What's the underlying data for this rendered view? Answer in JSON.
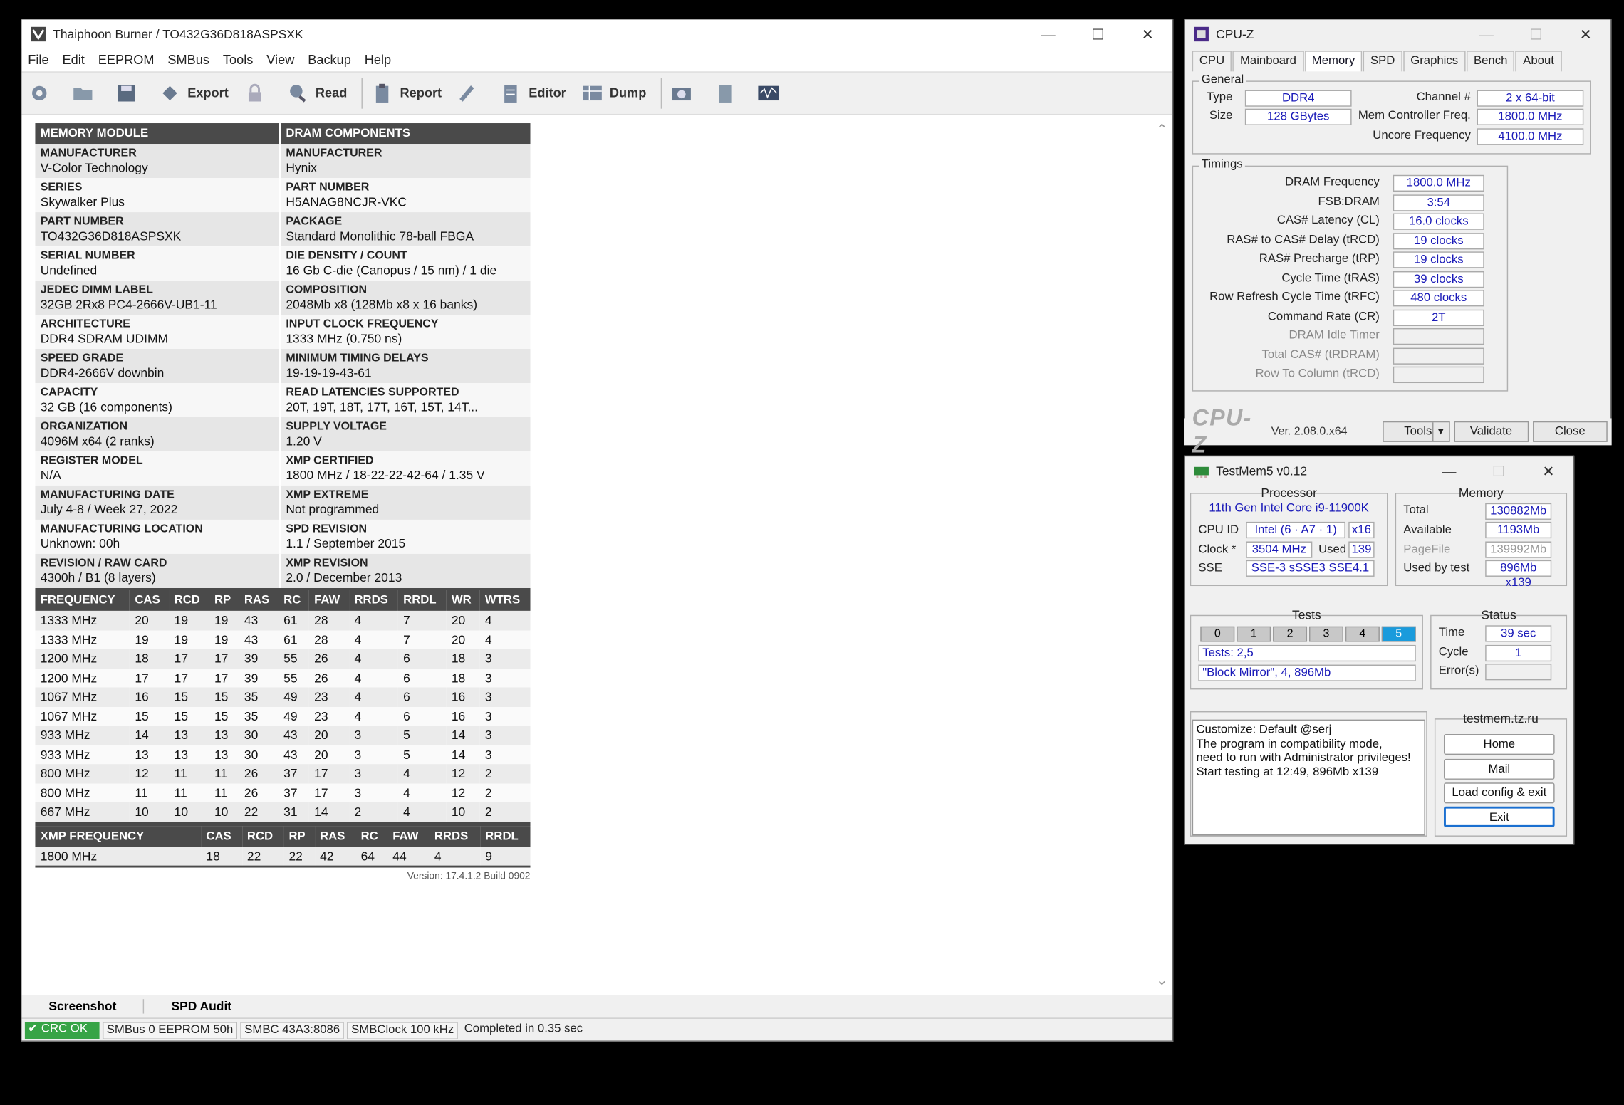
{
  "thaiphoon": {
    "title": "Thaiphoon Burner / TO432G36D818ASPSXK",
    "menu": [
      "File",
      "Edit",
      "EEPROM",
      "SMBus",
      "Tools",
      "View",
      "Backup",
      "Help"
    ],
    "toolbar": {
      "export": "Export",
      "read": "Read",
      "report": "Report",
      "editor": "Editor",
      "dump": "Dump"
    },
    "module_header": "MEMORY MODULE",
    "dram_header": "DRAM COMPONENTS",
    "rows": [
      {
        "l1": "MANUFACTURER",
        "v1": "V-Color Technology",
        "l2": "MANUFACTURER",
        "v2": "Hynix"
      },
      {
        "l1": "SERIES",
        "v1": "Skywalker Plus",
        "l2": "PART NUMBER",
        "v2": "H5ANAG8NCJR-VKC"
      },
      {
        "l1": "PART NUMBER",
        "v1": "TO432G36D818ASPSXK",
        "l2": "PACKAGE",
        "v2": "Standard Monolithic 78-ball FBGA"
      },
      {
        "l1": "SERIAL NUMBER",
        "v1": "Undefined",
        "l2": "DIE DENSITY / COUNT",
        "v2": "16 Gb C-die (Canopus / 15 nm) / 1 die"
      },
      {
        "l1": "JEDEC DIMM LABEL",
        "v1": "32GB 2Rx8 PC4-2666V-UB1-11",
        "l2": "COMPOSITION",
        "v2": "2048Mb x8 (128Mb x8 x 16 banks)"
      },
      {
        "l1": "ARCHITECTURE",
        "v1": "DDR4 SDRAM UDIMM",
        "l2": "INPUT CLOCK FREQUENCY",
        "v2": "1333 MHz (0.750 ns)"
      },
      {
        "l1": "SPEED GRADE",
        "v1": "DDR4-2666V downbin",
        "l2": "MINIMUM TIMING DELAYS",
        "v2": "19-19-19-43-61"
      },
      {
        "l1": "CAPACITY",
        "v1": "32 GB (16 components)",
        "l2": "READ LATENCIES SUPPORTED",
        "v2": "20T, 19T, 18T, 17T, 16T, 15T, 14T..."
      },
      {
        "l1": "ORGANIZATION",
        "v1": "4096M x64 (2 ranks)",
        "l2": "SUPPLY VOLTAGE",
        "v2": "1.20 V"
      },
      {
        "l1": "REGISTER MODEL",
        "v1": "N/A",
        "l2": "XMP CERTIFIED",
        "v2": "1800 MHz / 18-22-22-42-64 / 1.35 V"
      },
      {
        "l1": "MANUFACTURING DATE",
        "v1": "July 4-8 / Week 27, 2022",
        "l2": "XMP EXTREME",
        "v2": "Not programmed"
      },
      {
        "l1": "MANUFACTURING LOCATION",
        "v1": "Unknown: 00h",
        "l2": "SPD REVISION",
        "v2": "1.1 / September 2015"
      },
      {
        "l1": "REVISION / RAW CARD",
        "v1": "4300h / B1 (8 layers)",
        "l2": "XMP REVISION",
        "v2": "2.0 / December 2013"
      }
    ],
    "freq_headers": [
      "FREQUENCY",
      "CAS",
      "RCD",
      "RP",
      "RAS",
      "RC",
      "FAW",
      "RRDS",
      "RRDL",
      "WR",
      "WTRS"
    ],
    "freq_rows": [
      [
        "1333 MHz",
        "20",
        "19",
        "19",
        "43",
        "61",
        "28",
        "4",
        "7",
        "20",
        "4"
      ],
      [
        "1333 MHz",
        "19",
        "19",
        "19",
        "43",
        "61",
        "28",
        "4",
        "7",
        "20",
        "4"
      ],
      [
        "1200 MHz",
        "18",
        "17",
        "17",
        "39",
        "55",
        "26",
        "4",
        "6",
        "18",
        "3"
      ],
      [
        "1200 MHz",
        "17",
        "17",
        "17",
        "39",
        "55",
        "26",
        "4",
        "6",
        "18",
        "3"
      ],
      [
        "1067 MHz",
        "16",
        "15",
        "15",
        "35",
        "49",
        "23",
        "4",
        "6",
        "16",
        "3"
      ],
      [
        "1067 MHz",
        "15",
        "15",
        "15",
        "35",
        "49",
        "23",
        "4",
        "6",
        "16",
        "3"
      ],
      [
        "933 MHz",
        "14",
        "13",
        "13",
        "30",
        "43",
        "20",
        "3",
        "5",
        "14",
        "3"
      ],
      [
        "933 MHz",
        "13",
        "13",
        "13",
        "30",
        "43",
        "20",
        "3",
        "5",
        "14",
        "3"
      ],
      [
        "800 MHz",
        "12",
        "11",
        "11",
        "26",
        "37",
        "17",
        "3",
        "4",
        "12",
        "2"
      ],
      [
        "800 MHz",
        "11",
        "11",
        "11",
        "26",
        "37",
        "17",
        "3",
        "4",
        "12",
        "2"
      ],
      [
        "667 MHz",
        "10",
        "10",
        "10",
        "22",
        "31",
        "14",
        "2",
        "4",
        "10",
        "2"
      ]
    ],
    "xmp_headers": [
      "XMP FREQUENCY",
      "CAS",
      "RCD",
      "RP",
      "RAS",
      "RC",
      "FAW",
      "RRDS",
      "RRDL"
    ],
    "xmp_rows": [
      [
        "1800 MHz",
        "18",
        "22",
        "22",
        "42",
        "64",
        "44",
        "4",
        "9"
      ]
    ],
    "version": "Version: 17.4.1.2 Build 0902",
    "bottom_tabs": {
      "screenshot": "Screenshot",
      "audit": "SPD Audit"
    },
    "status": {
      "crc": "CRC OK",
      "smbus": "SMBus 0 EEPROM 50h",
      "smbc": "SMBC 43A3:8086",
      "clock": "SMBClock 100 kHz",
      "completed": "Completed in 0.35 sec"
    }
  },
  "cpuz": {
    "title": "CPU-Z",
    "tabs": [
      "CPU",
      "Mainboard",
      "Memory",
      "SPD",
      "Graphics",
      "Bench",
      "About"
    ],
    "general_label": "General",
    "type_label": "Type",
    "type": "DDR4",
    "size_label": "Size",
    "size": "128 GBytes",
    "channel_label": "Channel #",
    "channel": "2 x 64-bit",
    "mcf_label": "Mem Controller Freq.",
    "mcf": "1800.0 MHz",
    "uncore_label": "Uncore Frequency",
    "uncore": "4100.0 MHz",
    "timings_label": "Timings",
    "timings": [
      {
        "label": "DRAM Frequency",
        "value": "1800.0 MHz"
      },
      {
        "label": "FSB:DRAM",
        "value": "3:54"
      },
      {
        "label": "CAS# Latency (CL)",
        "value": "16.0 clocks"
      },
      {
        "label": "RAS# to CAS# Delay (tRCD)",
        "value": "19 clocks"
      },
      {
        "label": "RAS# Precharge (tRP)",
        "value": "19 clocks"
      },
      {
        "label": "Cycle Time (tRAS)",
        "value": "39 clocks"
      },
      {
        "label": "Row Refresh Cycle Time (tRFC)",
        "value": "480 clocks"
      },
      {
        "label": "Command Rate (CR)",
        "value": "2T"
      },
      {
        "label": "DRAM Idle Timer",
        "value": ""
      },
      {
        "label": "Total CAS# (tRDRAM)",
        "value": ""
      },
      {
        "label": "Row To Column (tRCD)",
        "value": ""
      }
    ],
    "logo": "CPU-Z",
    "version": "Ver. 2.08.0.x64",
    "tools": "Tools",
    "validate": "Validate",
    "close": "Close"
  },
  "testmem": {
    "title": "TestMem5 v0.12",
    "processor_label": "Processor",
    "processor": "11th Gen Intel Core i9-11900K",
    "cpuid_label": "CPU ID",
    "cpuid": "Intel  (6 · A7 · 1)",
    "threads": "x16",
    "clock_label": "Clock *",
    "clock": "3504 MHz",
    "used_label": "Used",
    "used": "139",
    "sse_label": "SSE",
    "sse": "SSE-3 sSSE3 SSE4.1",
    "memory_label": "Memory",
    "total_label": "Total",
    "total": "130882Mb",
    "available_label": "Available",
    "available": "1193Mb",
    "pagefile_label": "PageFile",
    "pagefile": "139992Mb",
    "usedbytest_label": "Used by test",
    "usedbytest": "896Mb x139",
    "tests_label": "Tests",
    "test_numbers": [
      "0",
      "1",
      "2",
      "3",
      "4",
      "5"
    ],
    "tests_line": "Tests: 2,5",
    "block_line": "\"Block Mirror\", 4, 896Mb",
    "status_label": "Status",
    "time_label": "Time",
    "time": "39 sec",
    "cycle_label": "Cycle",
    "cycle": "1",
    "errors_label": "Error(s)",
    "errors": "",
    "site_label": "testmem.tz.ru",
    "log": "Customize: Default @serj\nThe program in compatibility mode,\nneed to run with Administrator privileges!\nStart testing at 12:49, 896Mb x139",
    "buttons": {
      "home": "Home",
      "mail": "Mail",
      "load": "Load config & exit",
      "exit": "Exit"
    },
    "accent": "#1a9bdc"
  }
}
